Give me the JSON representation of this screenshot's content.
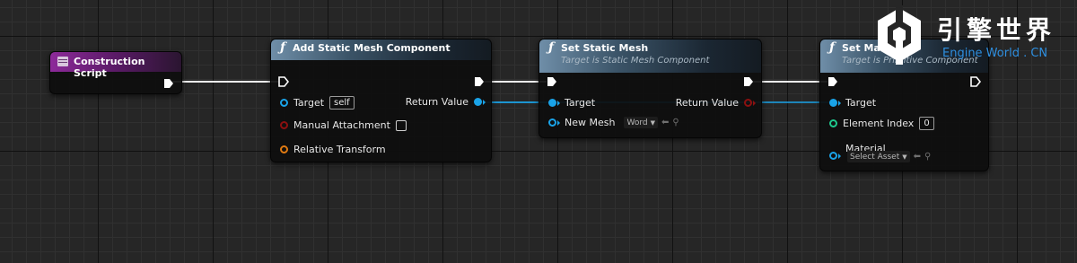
{
  "nodes": {
    "construction_script": {
      "title": "Construction Script"
    },
    "add_static_mesh_component": {
      "title": "Add Static Mesh Component",
      "pins": {
        "target_label": "Target",
        "target_value": "self",
        "manual_attachment_label": "Manual Attachment",
        "relative_transform_label": "Relative Transform",
        "return_value_label": "Return Value"
      }
    },
    "set_static_mesh": {
      "title": "Set Static Mesh",
      "subtitle": "Target is Static Mesh Component",
      "pins": {
        "target_label": "Target",
        "new_mesh_label": "New Mesh",
        "new_mesh_value": "Word",
        "return_value_label": "Return Value"
      }
    },
    "set_material": {
      "title": "Set Material",
      "subtitle": "Target is Primitive Component",
      "pins": {
        "target_label": "Target",
        "element_index_label": "Element Index",
        "element_index_value": "0",
        "material_label": "Material",
        "material_value": "Select Asset"
      }
    }
  },
  "watermark": {
    "chinese_text": "引擎世界",
    "english_text": "Engine World . CN"
  },
  "icons": {
    "function": "function-icon",
    "exec": "exec-pin-icon",
    "dropdown": "chevron-down-icon",
    "use_selected": "arrow-left-icon",
    "browse": "search-icon"
  },
  "colors": {
    "exec_wire": "#ffffff",
    "object_pin": "#1aa3e8",
    "struct_pin": "#e07a12",
    "bool_pin": "#8c1010",
    "int_pin": "#1ec98e",
    "function_header": "#3b5468",
    "event_header": "#8d2a9a",
    "logo_accent": "#2e8fe0"
  }
}
